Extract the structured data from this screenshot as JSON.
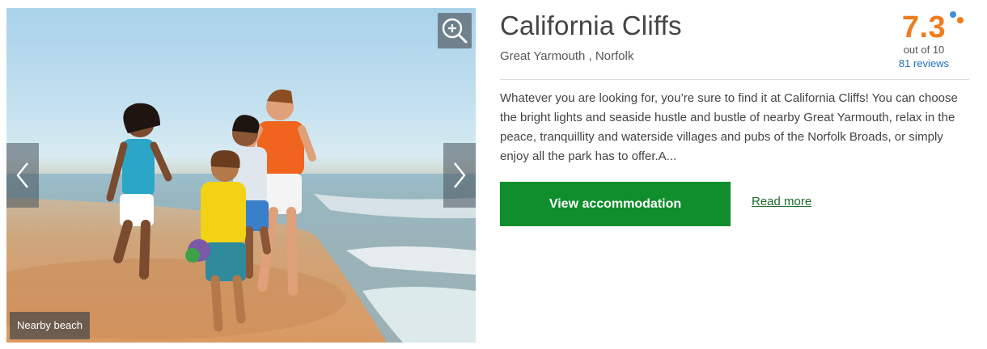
{
  "gallery": {
    "caption": "Nearby beach"
  },
  "property": {
    "title": "California Cliffs",
    "location": "Great Yarmouth , Norfolk",
    "description": "Whatever you are looking for, you’re sure to find it at California Cliffs! You can choose the bright lights and seaside hustle and bustle of nearby Great Yarmouth, relax in the peace, tranquillity and waterside villages and pubs of the Norfolk Broads, or simply enjoy all the park has to offer.A..."
  },
  "rating": {
    "score": "7.3",
    "out_of": "out of 10",
    "reviews": "81 reviews"
  },
  "actions": {
    "view_label": "View accommodation",
    "read_more_label": "Read more"
  },
  "colors": {
    "accent_green": "#0f8e2b",
    "rating_orange": "#f07c1f",
    "link_blue": "#1f6fbf"
  },
  "icons": [
    "zoom-icon",
    "chevron-left-icon",
    "chevron-right-icon"
  ]
}
